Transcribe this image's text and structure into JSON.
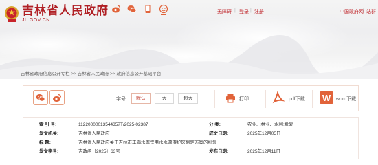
{
  "header": {
    "site_title": "吉林省人民政府",
    "site_domain": "JL.GOV.CN",
    "top_icons": [
      "weibo-icon",
      "wechat-icon",
      "mobile-icon",
      "elderly-care-icon"
    ],
    "links": {
      "accessibility": "无障碍",
      "login": "登录",
      "register": "注册",
      "china_gov": "中国政府网",
      "more": "站群"
    },
    "separator": "|"
  },
  "breadcrumb": {
    "items": [
      "吉林省政府信息公开专栏",
      "吉林省人民政府",
      "政府信息公开基础平台"
    ],
    "separator": ">>"
  },
  "toolbar": {
    "font_size_label": "字号:",
    "font_sizes": [
      "默认",
      "大",
      "超大"
    ],
    "selected_font_size": "默认",
    "print_label": "打印",
    "pdf_label": "pdf下载",
    "word_label": "word下载",
    "accent": "#e1633a"
  },
  "info": {
    "index_no": {
      "label": "索 引 号:",
      "value": "11220000013544357T/2025-02387"
    },
    "category": {
      "label": "分    类:",
      "value": "农业、林业、水利;批复"
    },
    "issuer": {
      "label": "发文机关:",
      "value": "吉林省人民政府"
    },
    "written_date": {
      "label": "成文日期:",
      "value": "2025年12月05日"
    },
    "title": {
      "label": "标    题:",
      "value": "吉林省人民政府关于吉林市丰满水库饮用水水源保护区划定方案的批复"
    },
    "doc_no": {
      "label": "发文字号:",
      "value": "吉政函〔2025〕63号"
    },
    "publish_date": {
      "label": "发布日期:",
      "value": "2025年12月11日"
    }
  },
  "colors": {
    "brand_red": "#b01f24",
    "accent_orange": "#e1633a"
  }
}
